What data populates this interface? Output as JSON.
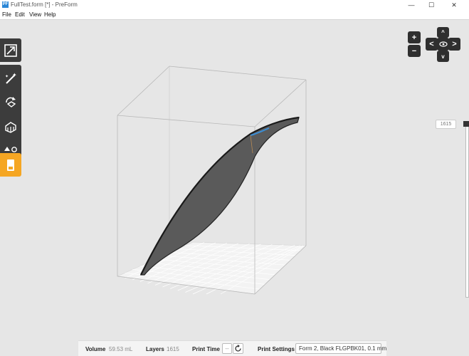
{
  "window": {
    "title": "FullTest.form [*] - PreForm",
    "app_icon_label": "PF",
    "minimize": "—",
    "maximize": "☐",
    "close": "✕"
  },
  "menu": [
    "File",
    "Edit",
    "View",
    "Help"
  ],
  "layer_slider": {
    "current_layer": "1615",
    "position": 1.0
  },
  "navigation": {
    "zoom_in": "+",
    "zoom_out": "−",
    "pan_up": "^",
    "pan_down": "v",
    "pan_left": "<",
    "pan_right": ">"
  },
  "status": {
    "volume_label": "Volume",
    "volume_value": "59.53 mL",
    "layers_label": "Layers",
    "layers_value": "1615",
    "print_time_label": "Print Time",
    "print_time_value": "--",
    "print_settings_label": "Print Settings",
    "print_settings_value": "Form 2, Black FLGPBK01, 0.1 mm"
  },
  "colors": {
    "background": "#e6e6e6",
    "toolbar": "#3c3c3c",
    "active_tool": "#f5a623",
    "model": "#5a5a5a",
    "support_highlight": "#3b8ed6"
  }
}
